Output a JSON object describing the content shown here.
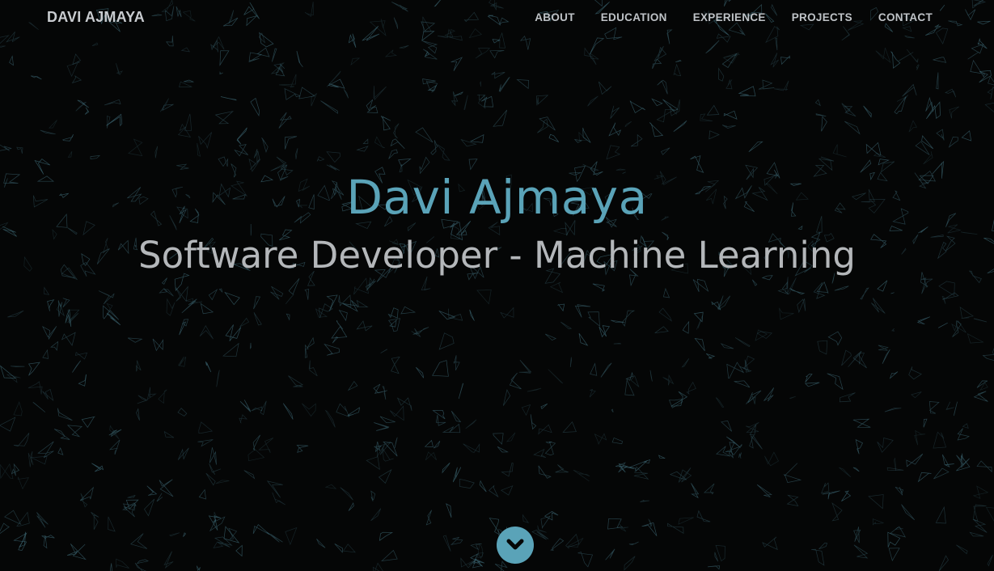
{
  "brand": "DAVI AJMAYA",
  "nav": {
    "items": [
      {
        "label": "ABOUT"
      },
      {
        "label": "EDUCATION"
      },
      {
        "label": "EXPERIENCE"
      },
      {
        "label": "PROJECTS"
      },
      {
        "label": "CONTACT"
      }
    ]
  },
  "hero": {
    "name": "Davi Ajmaya",
    "title": "Software Developer - Machine Learning"
  },
  "scroll_button": {
    "icon": "chevron-down-icon"
  },
  "colors": {
    "background": "#050606",
    "accent": "#5aa3b8",
    "nav_text": "#bfc3c7",
    "subtitle_text": "#b4b7ba",
    "particle": "#3f6b78"
  }
}
